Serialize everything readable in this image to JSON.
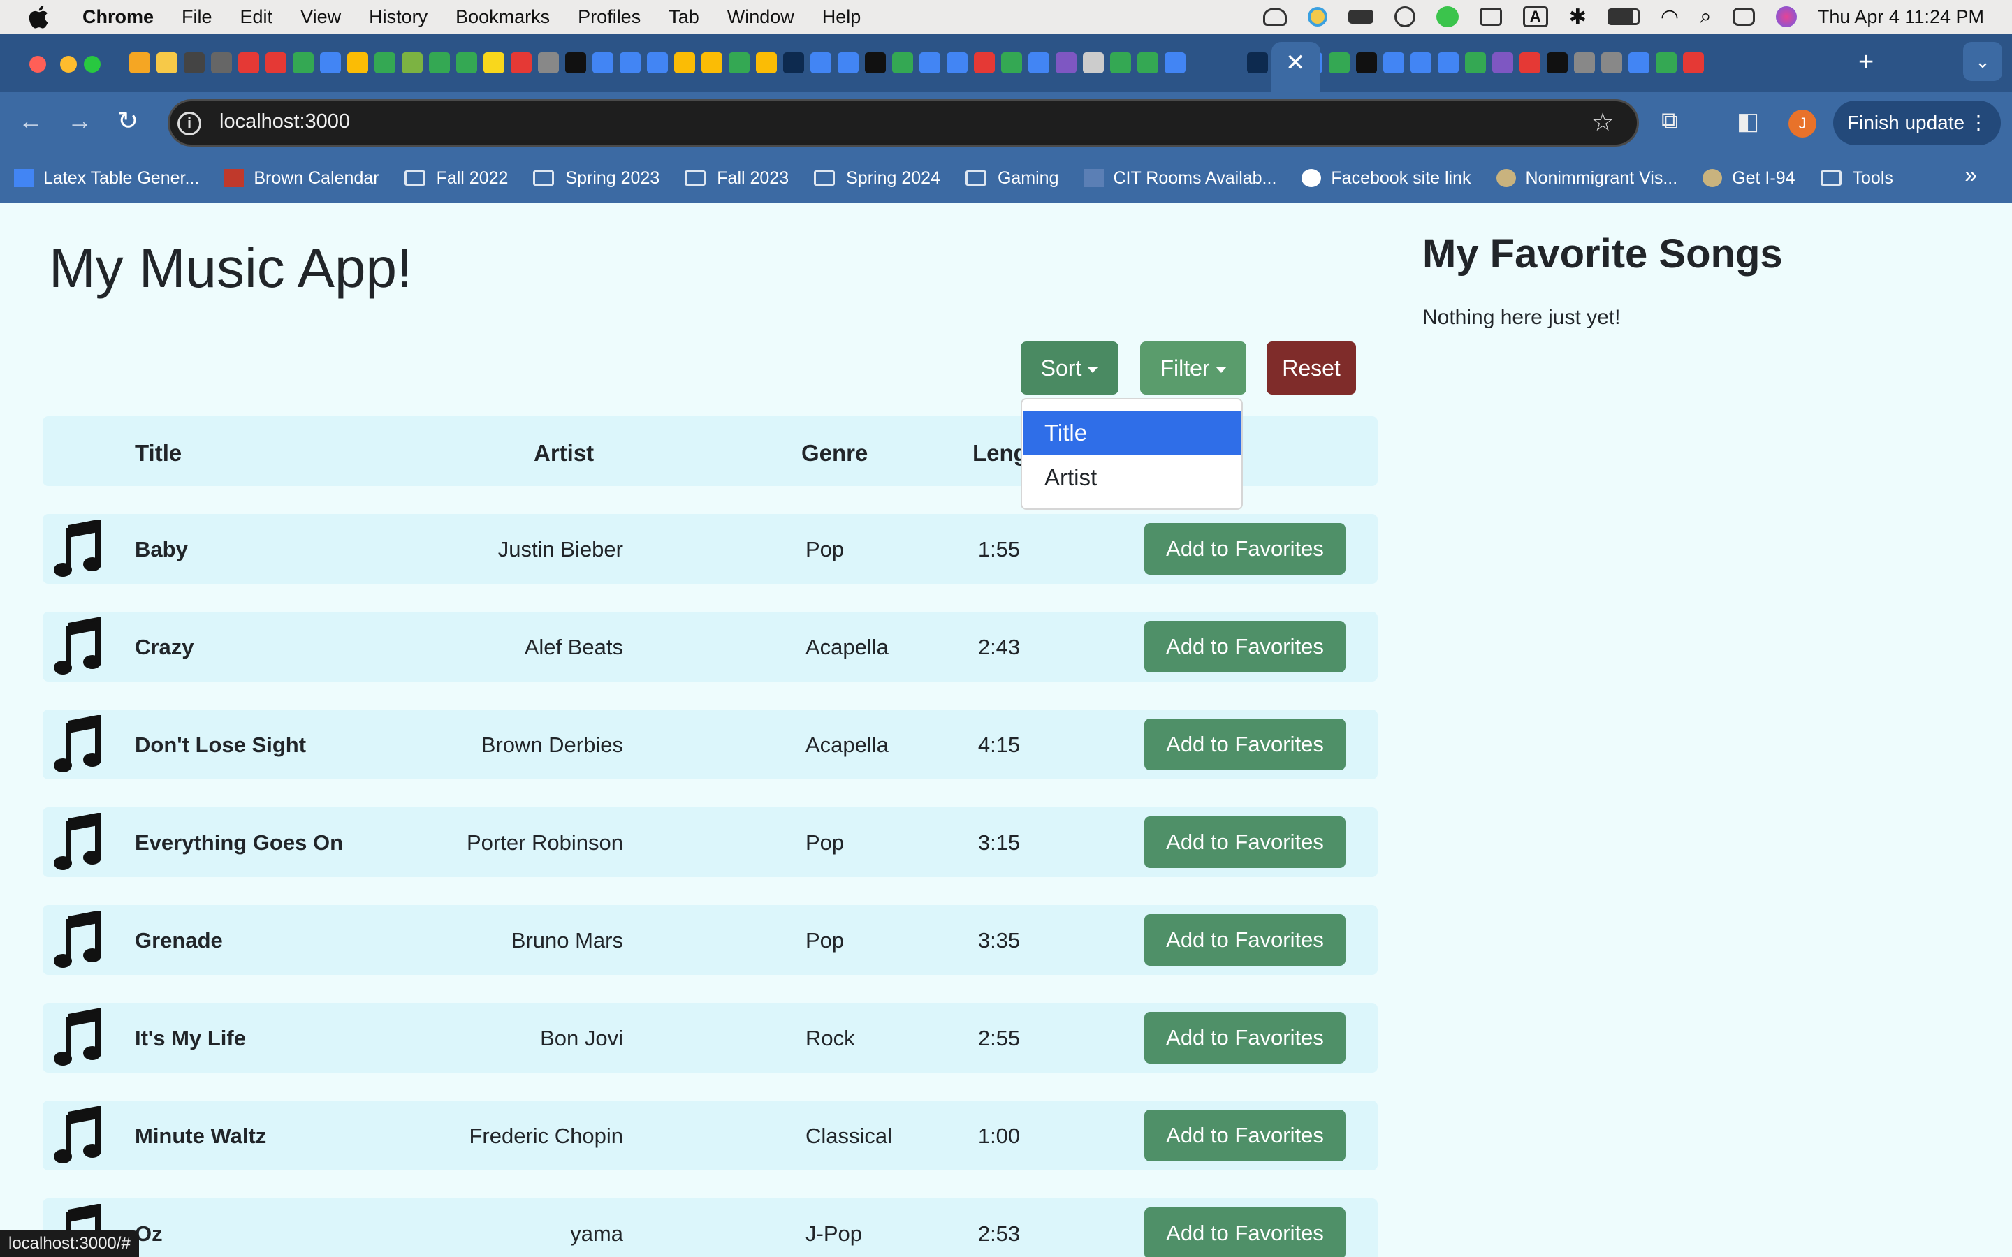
{
  "menubar": {
    "app": "Chrome",
    "items": [
      "File",
      "Edit",
      "View",
      "History",
      "Bookmarks",
      "Profiles",
      "Tab",
      "Window",
      "Help"
    ],
    "clock": "Thu Apr 4  11:24 PM"
  },
  "browser": {
    "url": "localhost:3000",
    "finish_update": "Finish update",
    "profile_initial": "J",
    "tab_close": "✕",
    "new_tab": "+"
  },
  "bookmarks": [
    {
      "label": "Latex Table Gener...",
      "icon": "table-icon"
    },
    {
      "label": "Brown Calendar",
      "icon": "brown-crest-icon"
    },
    {
      "label": "Fall 2022",
      "icon": "folder-icon"
    },
    {
      "label": "Spring 2023",
      "icon": "folder-icon"
    },
    {
      "label": "Fall 2023",
      "icon": "folder-icon"
    },
    {
      "label": "Spring 2024",
      "icon": "folder-icon"
    },
    {
      "label": "Gaming",
      "icon": "folder-icon"
    },
    {
      "label": "CIT Rooms Availab...",
      "icon": "cs-icon"
    },
    {
      "label": "Facebook site link",
      "icon": "globe-icon"
    },
    {
      "label": "Nonimmigrant Vis...",
      "icon": "seal-icon"
    },
    {
      "label": "Get I-94",
      "icon": "seal-icon"
    },
    {
      "label": "Tools",
      "icon": "folder-icon"
    }
  ],
  "page": {
    "title": "My Music App!",
    "controls": {
      "sort": "Sort",
      "filter": "Filter",
      "reset": "Reset"
    },
    "sort_menu": {
      "items": [
        "Title",
        "Artist"
      ],
      "highlighted": "Title"
    },
    "columns": {
      "title": "Title",
      "artist": "Artist",
      "genre": "Genre",
      "length": "Leng"
    },
    "add_label": "Add to Favorites",
    "songs": [
      {
        "title": "Baby",
        "artist": "Justin Bieber",
        "genre": "Pop",
        "length": "1:55"
      },
      {
        "title": "Crazy",
        "artist": "Alef Beats",
        "genre": "Acapella",
        "length": "2:43"
      },
      {
        "title": "Don't Lose Sight",
        "artist": "Brown Derbies",
        "genre": "Acapella",
        "length": "4:15"
      },
      {
        "title": "Everything Goes On",
        "artist": "Porter Robinson",
        "genre": "Pop",
        "length": "3:15"
      },
      {
        "title": "Grenade",
        "artist": "Bruno Mars",
        "genre": "Pop",
        "length": "3:35"
      },
      {
        "title": "It's My Life",
        "artist": "Bon Jovi",
        "genre": "Rock",
        "length": "2:55"
      },
      {
        "title": "Minute Waltz",
        "artist": "Frederic Chopin",
        "genre": "Classical",
        "length": "1:00"
      },
      {
        "title": "Oz",
        "artist": "yama",
        "genre": "J-Pop",
        "length": "2:53"
      }
    ]
  },
  "favorites": {
    "heading": "My Favorite Songs",
    "empty_text": "Nothing here just yet!"
  },
  "status_url": "localhost:3000/#",
  "colors": {
    "page_bg": "#eefcfd",
    "row_bg": "#dcf6fb",
    "success": "#4f9068",
    "danger": "#7f2c2a",
    "dropdown_active": "#2f6ee8",
    "toolbar": "#3c6aa3",
    "tabstrip": "#2c5487"
  }
}
